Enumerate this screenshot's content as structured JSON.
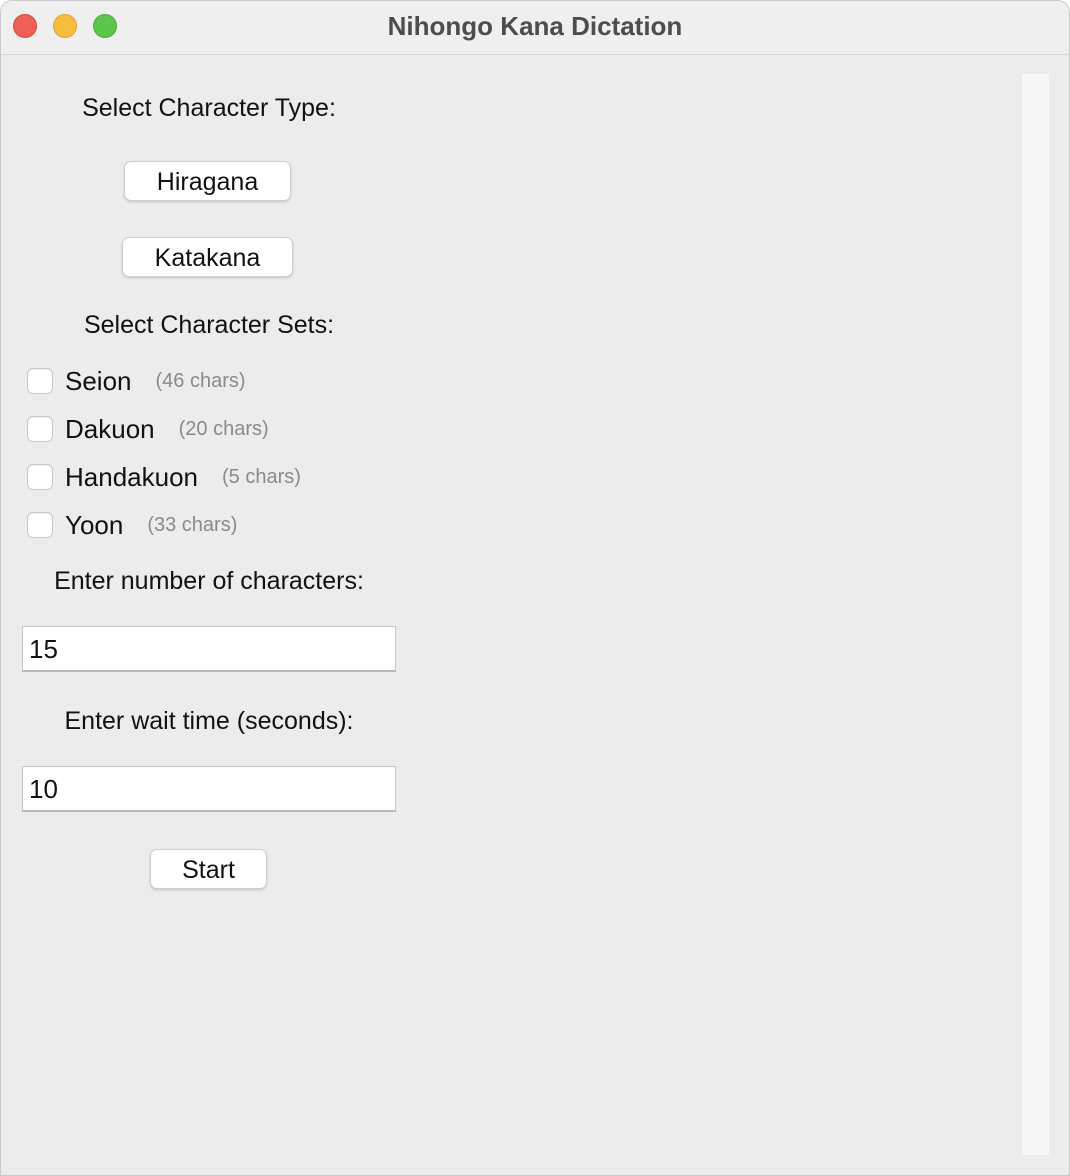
{
  "window": {
    "title": "Nihongo Kana Dictation"
  },
  "character_type": {
    "heading": "Select Character Type:",
    "buttons": [
      {
        "label": "Hiragana"
      },
      {
        "label": "Katakana"
      }
    ]
  },
  "character_sets": {
    "heading": "Select Character Sets:",
    "items": [
      {
        "name": "Seion",
        "count": "(46 chars)",
        "checked": false
      },
      {
        "name": "Dakuon",
        "count": "(20 chars)",
        "checked": false
      },
      {
        "name": "Handakuon",
        "count": "(5 chars)",
        "checked": false
      },
      {
        "name": "Yoon",
        "count": "(33 chars)",
        "checked": false
      }
    ]
  },
  "num_chars": {
    "label": "Enter number of characters:",
    "value": "15"
  },
  "wait_time": {
    "label": "Enter wait time (seconds):",
    "value": "10"
  },
  "start_button": {
    "label": "Start"
  },
  "colors": {
    "close": "#ee5f58",
    "minimize": "#f8bd3f",
    "maximize": "#5ec54d",
    "window_bg": "#ececec"
  }
}
